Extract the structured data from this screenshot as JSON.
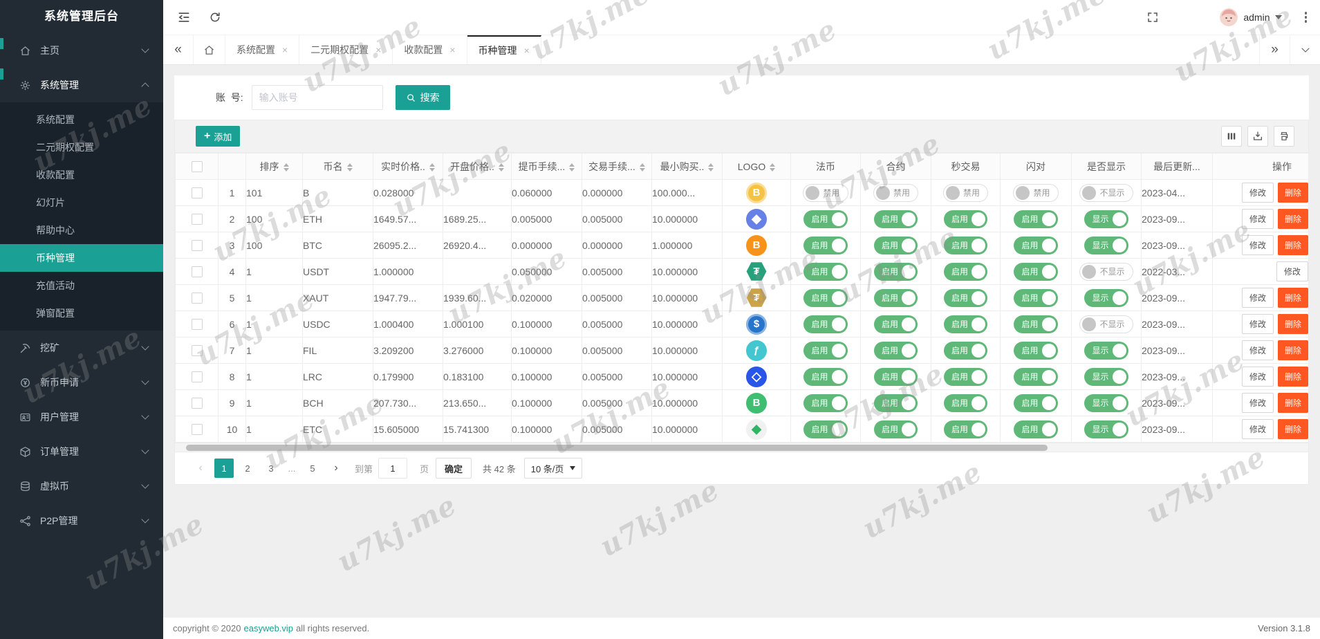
{
  "app": {
    "sidebar_title": "系统管理后台",
    "footer": {
      "copyright_prefix": "copyright © 2020",
      "copyright_link": "easyweb.vip",
      "copyright_suffix": "all rights reserved.",
      "version": "Version 3.1.8"
    }
  },
  "watermark": {
    "text": "u7kj.me"
  },
  "topbar": {
    "username": "admin"
  },
  "sidebar": {
    "items": [
      {
        "id": "home",
        "label": "主页",
        "icon": "home-icon",
        "state": "collapsed"
      },
      {
        "id": "system",
        "label": "系统管理",
        "icon": "gear-icon",
        "state": "expanded",
        "children": [
          {
            "label": "系统配置"
          },
          {
            "label": "二元期权配置"
          },
          {
            "label": "收款配置"
          },
          {
            "label": "幻灯片"
          },
          {
            "label": "帮助中心"
          },
          {
            "label": "币种管理",
            "active": true
          },
          {
            "label": "充值活动"
          },
          {
            "label": "弹窗配置"
          }
        ]
      },
      {
        "id": "mining",
        "label": "挖矿",
        "icon": "pickaxe-icon",
        "state": "collapsed"
      },
      {
        "id": "new-coin",
        "label": "新币申请",
        "icon": "coin-plus-icon",
        "state": "collapsed"
      },
      {
        "id": "users",
        "label": "用户管理",
        "icon": "id-card-icon",
        "state": "collapsed"
      },
      {
        "id": "orders",
        "label": "订单管理",
        "icon": "cube-icon",
        "state": "collapsed"
      },
      {
        "id": "virtual-coin",
        "label": "虚拟币",
        "icon": "coins-icon",
        "state": "collapsed"
      },
      {
        "id": "p2p",
        "label": "P2P管理",
        "icon": "network-icon",
        "state": "collapsed"
      }
    ]
  },
  "tabbar": {
    "tabs": [
      {
        "label": "系统配置"
      },
      {
        "label": "二元期权配置"
      },
      {
        "label": "收款配置"
      },
      {
        "label": "币种管理",
        "active": true
      }
    ]
  },
  "search": {
    "label": "账  号:",
    "placeholder": "输入账号",
    "button_label": "搜索"
  },
  "toolbar": {
    "add_label": "添加"
  },
  "table": {
    "headers": [
      {
        "type": "checkbox",
        "label": ""
      },
      {
        "type": "index",
        "label": ""
      },
      {
        "label": "排序",
        "sortable": true
      },
      {
        "label": "币名",
        "sortable": true
      },
      {
        "label": "实时价格..",
        "sortable": true
      },
      {
        "label": "开盘价格..",
        "sortable": true
      },
      {
        "label": "提币手续...",
        "sortable": true
      },
      {
        "label": "交易手续...",
        "sortable": true
      },
      {
        "label": "最小购买..",
        "sortable": true
      },
      {
        "label": "LOGO",
        "sortable": true
      },
      {
        "label": "法币"
      },
      {
        "label": "合约"
      },
      {
        "label": "秒交易"
      },
      {
        "label": "闪对"
      },
      {
        "label": "是否显示"
      },
      {
        "label": "最后更新..."
      },
      {
        "label": "操作"
      }
    ],
    "toggle_labels": {
      "on": "启用",
      "off": "禁用",
      "show": "显示",
      "hide": "不显示"
    },
    "action_labels": {
      "edit": "修改",
      "delete": "删除"
    },
    "rows": [
      {
        "index": "1",
        "sort": "101",
        "name": "B",
        "price": "0.028000",
        "open": "",
        "withdraw_fee": "0.060000",
        "trade_fee": "0.000000",
        "min_buy": "100.000...",
        "logo": {
          "shape": "circle",
          "bg": "#F6C244",
          "color": "#FFFFFF",
          "glyph": "B",
          "ring": true
        },
        "fiat": false,
        "contract": false,
        "seconds": false,
        "flash": false,
        "visible": false,
        "updated": "2023-04...",
        "can_delete": true
      },
      {
        "index": "2",
        "sort": "100",
        "name": "ETH",
        "price": "1649.57...",
        "open": "1689.25...",
        "withdraw_fee": "0.005000",
        "trade_fee": "0.005000",
        "min_buy": "10.000000",
        "logo": {
          "shape": "circle",
          "bg": "#6780E5",
          "color": "#FFFFFF",
          "glyph": "◆",
          "big": true
        },
        "fiat": true,
        "contract": true,
        "seconds": true,
        "flash": true,
        "visible": true,
        "updated": "2023-09...",
        "can_delete": true
      },
      {
        "index": "3",
        "sort": "100",
        "name": "BTC",
        "price": "26095.2...",
        "open": "26920.4...",
        "withdraw_fee": "0.000000",
        "trade_fee": "0.000000",
        "min_buy": "1.000000",
        "logo": {
          "shape": "circle",
          "bg": "#F7931A",
          "color": "#FFFFFF",
          "glyph": "B"
        },
        "fiat": true,
        "contract": true,
        "seconds": true,
        "flash": true,
        "visible": true,
        "updated": "2023-09...",
        "can_delete": true
      },
      {
        "index": "4",
        "sort": "1",
        "name": "USDT",
        "price": "1.000000",
        "open": "",
        "withdraw_fee": "0.050000",
        "trade_fee": "0.005000",
        "min_buy": "10.000000",
        "logo": {
          "shape": "hex",
          "bg": "#26A17B",
          "color": "#FFFFFF",
          "glyph": "₮"
        },
        "fiat": true,
        "contract": true,
        "seconds": true,
        "flash": true,
        "visible": false,
        "updated": "2022-03...",
        "can_delete": false
      },
      {
        "index": "5",
        "sort": "1",
        "name": "XAUT",
        "price": "1947.79...",
        "open": "1939.60...",
        "withdraw_fee": "0.020000",
        "trade_fee": "0.005000",
        "min_buy": "10.000000",
        "logo": {
          "shape": "hex",
          "bg": "#CBA44A",
          "color": "#FFFFFF",
          "glyph": "₮"
        },
        "fiat": true,
        "contract": true,
        "seconds": true,
        "flash": true,
        "visible": true,
        "updated": "2023-09...",
        "can_delete": true
      },
      {
        "index": "6",
        "sort": "1",
        "name": "USDC",
        "price": "1.000400",
        "open": "1.000100",
        "withdraw_fee": "0.100000",
        "trade_fee": "0.005000",
        "min_buy": "10.000000",
        "logo": {
          "shape": "circle",
          "bg": "#2775CA",
          "color": "#FFFFFF",
          "glyph": "$",
          "ring": true
        },
        "fiat": true,
        "contract": true,
        "seconds": true,
        "flash": true,
        "visible": false,
        "updated": "2023-09...",
        "can_delete": true
      },
      {
        "index": "7",
        "sort": "1",
        "name": "FIL",
        "price": "3.209200",
        "open": "3.276000",
        "withdraw_fee": "0.100000",
        "trade_fee": "0.005000",
        "min_buy": "10.000000",
        "logo": {
          "shape": "circle",
          "bg": "#43C6D0",
          "color": "#FFFFFF",
          "glyph": "ƒ"
        },
        "fiat": true,
        "contract": true,
        "seconds": true,
        "flash": true,
        "visible": true,
        "updated": "2023-09...",
        "can_delete": true
      },
      {
        "index": "8",
        "sort": "1",
        "name": "LRC",
        "price": "0.179900",
        "open": "0.183100",
        "withdraw_fee": "0.100000",
        "trade_fee": "0.005000",
        "min_buy": "10.000000",
        "logo": {
          "shape": "circle",
          "bg": "#2956E8",
          "color": "#FFFFFF",
          "glyph": "◇",
          "big": true
        },
        "fiat": true,
        "contract": true,
        "seconds": true,
        "flash": true,
        "visible": true,
        "updated": "2023-09...",
        "can_delete": true
      },
      {
        "index": "9",
        "sort": "1",
        "name": "BCH",
        "price": "207.730...",
        "open": "213.650...",
        "withdraw_fee": "0.100000",
        "trade_fee": "0.005000",
        "min_buy": "10.000000",
        "logo": {
          "shape": "circle",
          "bg": "#3FBD71",
          "color": "#FFFFFF",
          "glyph": "B"
        },
        "fiat": true,
        "contract": true,
        "seconds": true,
        "flash": true,
        "visible": true,
        "updated": "2023-09...",
        "can_delete": true
      },
      {
        "index": "10",
        "sort": "1",
        "name": "ETC",
        "price": "15.605000",
        "open": "15.741300",
        "withdraw_fee": "0.100000",
        "trade_fee": "0.005000",
        "min_buy": "10.000000",
        "logo": {
          "shape": "circle",
          "bg": "#F1F1F1",
          "color": "#31B463",
          "glyph": "◆",
          "big": true
        },
        "fiat": true,
        "contract": true,
        "seconds": true,
        "flash": true,
        "visible": true,
        "updated": "2023-09...",
        "can_delete": true
      }
    ]
  },
  "pagination": {
    "prev": "‹",
    "next": "›",
    "pages": [
      "1",
      "2",
      "3",
      "...",
      "5"
    ],
    "active_page": "1",
    "goto_label": "到第",
    "goto_value": "1",
    "goto_unit": "页",
    "confirm_label": "确定",
    "total_label": "共 42 条",
    "page_size_label": "10 条/页"
  },
  "colors": {
    "primary": "#1AA094",
    "toggle_on": "#5FB878",
    "danger": "#FF5722",
    "sidebar_bg": "#222B34"
  }
}
